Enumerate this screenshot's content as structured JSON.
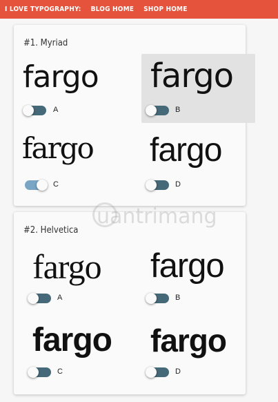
{
  "topbar": {
    "brand": "I LOVE TYPOGRAPHY:",
    "links": [
      "BLOG HOME",
      "SHOP HOME"
    ],
    "color": "#e5533c"
  },
  "cards": [
    {
      "title": "#1. Myriad",
      "options": [
        {
          "word": "fargo",
          "letter": "A",
          "toggle_on": false,
          "selected": false
        },
        {
          "word": "fargo",
          "letter": "B",
          "toggle_on": false,
          "selected": true
        },
        {
          "word": "fargo",
          "letter": "C",
          "toggle_on": true,
          "selected": false
        },
        {
          "word": "fargo",
          "letter": "D",
          "toggle_on": false,
          "selected": false
        }
      ]
    },
    {
      "title": "#2. Helvetica",
      "options": [
        {
          "word": "fargo",
          "letter": "A",
          "toggle_on": false,
          "selected": false
        },
        {
          "word": "fargo",
          "letter": "B",
          "toggle_on": false,
          "selected": false
        },
        {
          "word": "fargo",
          "letter": "C",
          "toggle_on": false,
          "selected": false
        },
        {
          "word": "fargo",
          "letter": "D",
          "toggle_on": false,
          "selected": false
        }
      ]
    }
  ],
  "watermark": "uantrimang",
  "toggle_colors": {
    "off_track": "#466979",
    "on_track": "#7aa5c4"
  }
}
